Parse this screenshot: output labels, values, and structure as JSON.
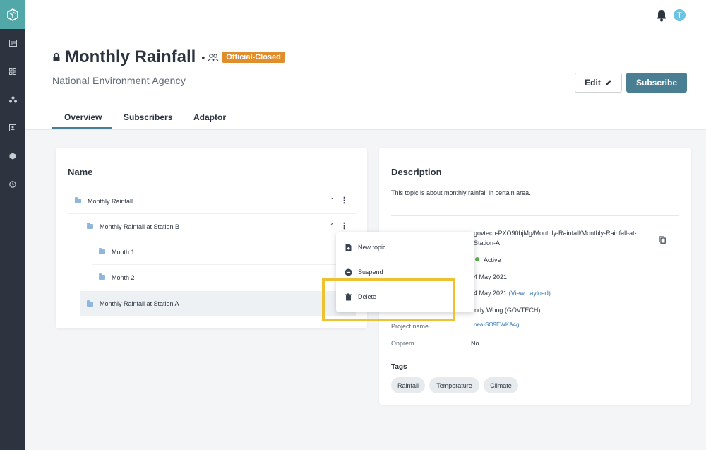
{
  "sidebar": {
    "items": [
      {
        "icon": "catalog-icon"
      },
      {
        "icon": "grid-icon"
      },
      {
        "icon": "network-icon"
      },
      {
        "icon": "image-icon"
      },
      {
        "icon": "box-icon"
      },
      {
        "icon": "clock-icon"
      }
    ]
  },
  "header": {
    "avatar_initial": "T",
    "title": "Monthly Rainfall",
    "separator": "•",
    "badge": "Official-Closed",
    "organization": "National Environment Agency",
    "edit_label": "Edit",
    "subscribe_label": "Subscribe"
  },
  "tabs": [
    {
      "label": "Overview",
      "active": true
    },
    {
      "label": "Subscribers"
    },
    {
      "label": "Adaptor"
    }
  ],
  "tree": {
    "title": "Name",
    "rows": [
      {
        "label": "Monthly Rainfall",
        "level": 0,
        "expanded": true
      },
      {
        "label": "Monthly Rainfall at Station B",
        "level": 1,
        "expanded": true
      },
      {
        "label": "Month 1",
        "level": 2
      },
      {
        "label": "Month 2",
        "level": 2
      },
      {
        "label": "Monthly Rainfall at Station A",
        "level": 1,
        "selected": true
      }
    ]
  },
  "context_menu": {
    "items": [
      {
        "label": "New topic",
        "icon": "add-file-icon"
      },
      {
        "label": "Suspend",
        "icon": "suspend-icon"
      },
      {
        "label": "Delete",
        "icon": "trash-icon"
      }
    ]
  },
  "description": {
    "title": "Description",
    "text": "This topic is about monthly rainfall in certain area.",
    "topic_path_line1": "govtech-PXO90bjMg/Monthly-Rainfall/Monthly-Rainfall-at-",
    "topic_path_line2": "Station-A",
    "status": "Active",
    "created_date": "4 May 2021",
    "updated_date": "4 May 2021",
    "view_payload": "(View payload)",
    "created_by_value": "Andy Wong (GOVTECH)",
    "project_name_label": "Project name",
    "project_name_value": "nea-SO9EWKA4g",
    "onprem_label": "Onprem",
    "onprem_value": "No",
    "tags_title": "Tags",
    "tags": [
      "Rainfall",
      "Temperature",
      "Climate"
    ]
  },
  "colors": {
    "sidebar": "#2d3440",
    "accent": "#4a7f93",
    "badge": "#e08d2c",
    "highlight": "#eec133",
    "status_active": "#58b24a"
  }
}
